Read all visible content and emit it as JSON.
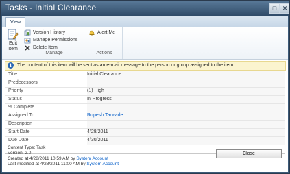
{
  "window": {
    "title": "Tasks - Initial Clearance",
    "maximize_glyph": "□",
    "close_glyph": "✕"
  },
  "ribbon": {
    "tab": "View",
    "edit_item": "Edit Item",
    "manage": {
      "version_history": "Version History",
      "manage_permissions": "Manage Permissions",
      "delete_item": "Delete Item",
      "group_label": "Manage"
    },
    "actions": {
      "alert_me": "Alert Me",
      "group_label": "Actions"
    }
  },
  "info": {
    "icon": "i",
    "message": "The content of this item will be sent as an e-mail message to the person or group assigned to the item."
  },
  "fields": [
    {
      "label": "Title",
      "value": "Initial Clearance"
    },
    {
      "label": "Predecessors",
      "value": ""
    },
    {
      "label": "Priority",
      "value": "(1) High"
    },
    {
      "label": "Status",
      "value": "In Progress"
    },
    {
      "label": "% Complete",
      "value": ""
    },
    {
      "label": "Assigned To",
      "value": "Rupesh Tarwade"
    },
    {
      "label": "Description",
      "value": ""
    },
    {
      "label": "Start Date",
      "value": "4/28/2011"
    },
    {
      "label": "Due Date",
      "value": "4/30/2011"
    }
  ],
  "footer": {
    "content_type": "Content Type: Task",
    "version": "Version: 2.0",
    "created_prefix": "Created at 4/28/2011 10:59 AM  by",
    "created_by": "System Account",
    "modified_prefix": "Last modified at 4/28/2011 11:00 AM  by",
    "modified_by": "System Account"
  },
  "buttons": {
    "close": "Close"
  },
  "icons": [
    "edit-item-icon",
    "version-history-icon",
    "manage-permissions-icon",
    "delete-item-icon",
    "alert-me-icon",
    "info-icon",
    "maximize-icon",
    "close-icon"
  ],
  "colors": {
    "titlebar": "#3d5a78",
    "link": "#0a61c9",
    "info_bar": "#fbf4cf"
  }
}
